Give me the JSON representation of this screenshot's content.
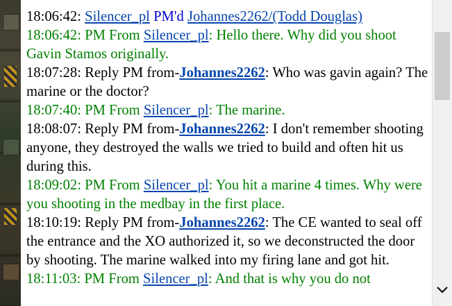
{
  "chat": {
    "messages": [
      {
        "time": "18:06:42:",
        "sender": "Silencer_pl",
        "verb": "PM'd",
        "recipient": "Johannes2262/(Todd Douglas)"
      },
      {
        "time": "18:06:42:",
        "prefix": "PM From",
        "sender": "Silencer_pl",
        "text": ": Hello there. Why did you shoot Gavin Stamos originally."
      },
      {
        "time": "18:07:28:",
        "prefix": "Reply PM from-",
        "sender": "Johannes2262",
        "text": ": Who was gavin again? The marine or the doctor?"
      },
      {
        "time": "18:07:40:",
        "prefix": "PM From",
        "sender": "Silencer_pl",
        "text": ": The marine."
      },
      {
        "time": "18:08:07:",
        "prefix": "Reply PM from-",
        "sender": "Johannes2262",
        "text": ": I don't remember shooting anyone, they destroyed the walls we tried to build and often hit us during this."
      },
      {
        "time": "18:09:02:",
        "prefix": "PM From",
        "sender": "Silencer_pl",
        "text": ": You hit a marine 4 times. Why were you shooting in the medbay in the first place."
      },
      {
        "time": "18:10:19:",
        "prefix": "Reply PM from-",
        "sender": "Johannes2262",
        "text": ": The CE wanted to seal off the entrance and the XO authorized it, so we deconstructed the door by shooting. The marine walked into my firing lane and got hit."
      },
      {
        "time": "18:11:03:",
        "prefix": "PM From",
        "sender": "Silencer_pl",
        "text": ": And that is why you do not"
      }
    ]
  },
  "scrollbar": {
    "down_arrow_icon": "chevron-down-icon"
  },
  "colors": {
    "pm_from": "#008000",
    "link": "#0645ad",
    "pmd": "#0000cc",
    "text": "#000000"
  }
}
